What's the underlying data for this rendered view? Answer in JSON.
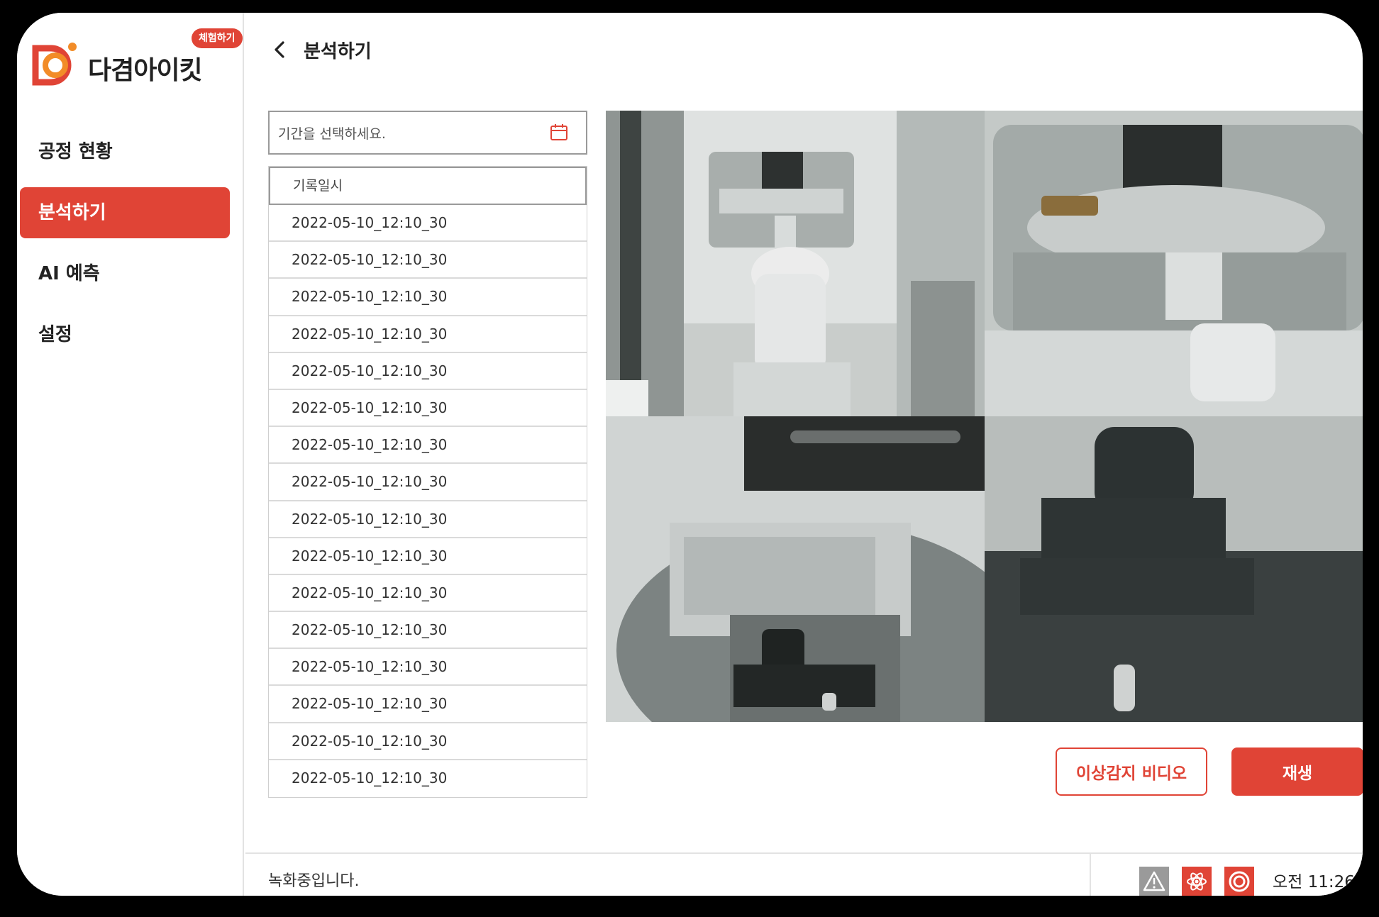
{
  "app": {
    "name": "다겸아이킷",
    "badge": "체험하기",
    "brand_color": "#e04436"
  },
  "sidebar": {
    "items": [
      {
        "label": "공정 현황"
      },
      {
        "label": "분석하기"
      },
      {
        "label": "AI 예측"
      },
      {
        "label": "설정"
      }
    ]
  },
  "header": {
    "title": "분석하기",
    "back_icon": "chevron-left-icon"
  },
  "date_picker": {
    "placeholder": "기간을 선택하세요.",
    "icon": "calendar-icon"
  },
  "records": {
    "column_header": "기록일시",
    "rows": [
      "2022-05-10_12:10_30",
      "2022-05-10_12:10_30",
      "2022-05-10_12:10_30",
      "2022-05-10_12:10_30",
      "2022-05-10_12:10_30",
      "2022-05-10_12:10_30",
      "2022-05-10_12:10_30",
      "2022-05-10_12:10_30",
      "2022-05-10_12:10_30",
      "2022-05-10_12:10_30",
      "2022-05-10_12:10_30",
      "2022-05-10_12:10_30",
      "2022-05-10_12:10_30",
      "2022-05-10_12:10_30",
      "2022-05-10_12:10_30",
      "2022-05-10_12:10_30"
    ]
  },
  "buttons": {
    "anomaly_video": "이상감지 비디오",
    "play": "재생"
  },
  "status": {
    "message": "녹화중입니다.",
    "clock": "오전 11:26",
    "icons": [
      "warning-icon",
      "atom-icon",
      "record-icon"
    ]
  }
}
